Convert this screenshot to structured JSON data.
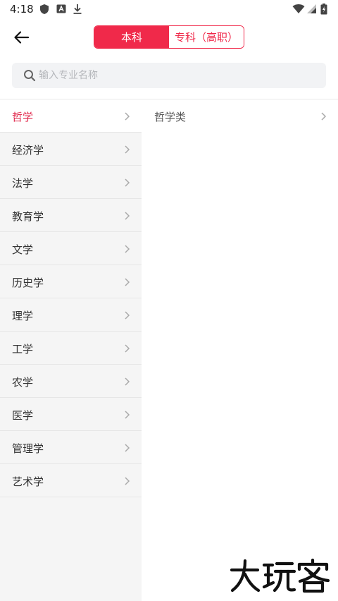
{
  "status_bar": {
    "time": "4:18",
    "left_icons": [
      "shield-icon",
      "keyboard-a-icon",
      "download-icon"
    ],
    "right_icons": [
      "wifi-icon",
      "cell-signal-icon",
      "battery-charging-icon"
    ]
  },
  "header": {
    "back_icon": "arrow-left-icon",
    "tabs": [
      {
        "label": "本科",
        "active": true
      },
      {
        "label": "专科（高职）",
        "active": false
      }
    ]
  },
  "search": {
    "placeholder": "输入专业名称",
    "value": ""
  },
  "categories": [
    {
      "label": "哲学",
      "active": true
    },
    {
      "label": "经济学",
      "active": false
    },
    {
      "label": "法学",
      "active": false
    },
    {
      "label": "教育学",
      "active": false
    },
    {
      "label": "文学",
      "active": false
    },
    {
      "label": "历史学",
      "active": false
    },
    {
      "label": "理学",
      "active": false
    },
    {
      "label": "工学",
      "active": false
    },
    {
      "label": "农学",
      "active": false
    },
    {
      "label": "医学",
      "active": false
    },
    {
      "label": "管理学",
      "active": false
    },
    {
      "label": "艺术学",
      "active": false
    }
  ],
  "subcategories": [
    {
      "label": "哲学类"
    }
  ],
  "watermark": {
    "text": "大玩客"
  },
  "colors": {
    "accent": "#f0294a",
    "active_text": "#e0264a",
    "panel_bg": "#f5f5f5",
    "search_bg": "#f2f3f5"
  }
}
